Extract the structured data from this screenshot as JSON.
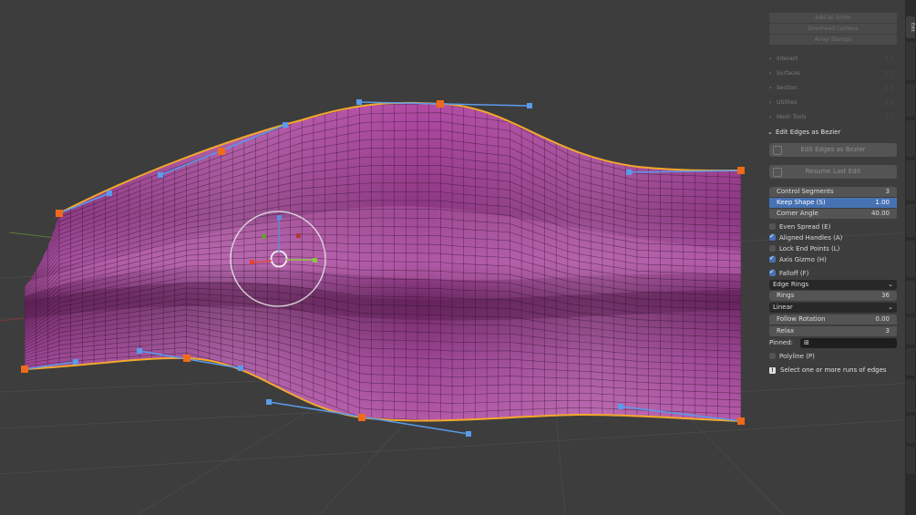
{
  "toolbar_buttons": [
    "Add as Scrim",
    "Overhead Camera",
    "Array Stamps"
  ],
  "collapsed_panels": [
    {
      "label": "Interact"
    },
    {
      "label": "Surfaces"
    },
    {
      "label": "Section"
    },
    {
      "label": "Utilities"
    },
    {
      "label": "Mesh Tools"
    }
  ],
  "operator_panel": {
    "title": "Edit Edges as Bezier",
    "run_button": "Edit Edges as Bezier",
    "resume_button": "Resume Last Edit",
    "fields": {
      "control_segments": {
        "label": "Control Segments",
        "value": "3"
      },
      "keep_shape": {
        "label": "Keep Shape (S)",
        "value": "1.00"
      },
      "corner_angle": {
        "label": "Corner Angle",
        "value": "40.00"
      }
    },
    "checks": {
      "even_spread": {
        "label": "Even Spread (E)",
        "checked": false
      },
      "aligned_handles": {
        "label": "Aligned Handles (A)",
        "checked": true
      },
      "lock_end_points": {
        "label": "Lock End Points (L)",
        "checked": false
      },
      "axis_gizmo": {
        "label": "Axis Gizmo (H)",
        "checked": true
      },
      "falloff": {
        "label": "Falloff (F)",
        "checked": true
      },
      "polyline": {
        "label": "Polyline (P)",
        "checked": false
      }
    },
    "falloff_mode": "Edge Rings",
    "rings": {
      "label": "Rings",
      "value": "36"
    },
    "interpolation": "Linear",
    "follow_rotation": {
      "label": "Follow Rotation",
      "value": "0.00"
    },
    "relax": {
      "label": "Relax",
      "value": "3"
    },
    "pinned_label": "Pinned:",
    "hint": "Select one or more runs of edges"
  },
  "sidebar_tabs": [
    "Edit"
  ],
  "colors": {
    "viewport_bg": "#3d3d3d",
    "mesh_surface": "#8e3a86",
    "curve": "#f3a92b",
    "control_point": "#f06a1a",
    "handle": "#5a9bea",
    "accent": "#4772b3"
  }
}
